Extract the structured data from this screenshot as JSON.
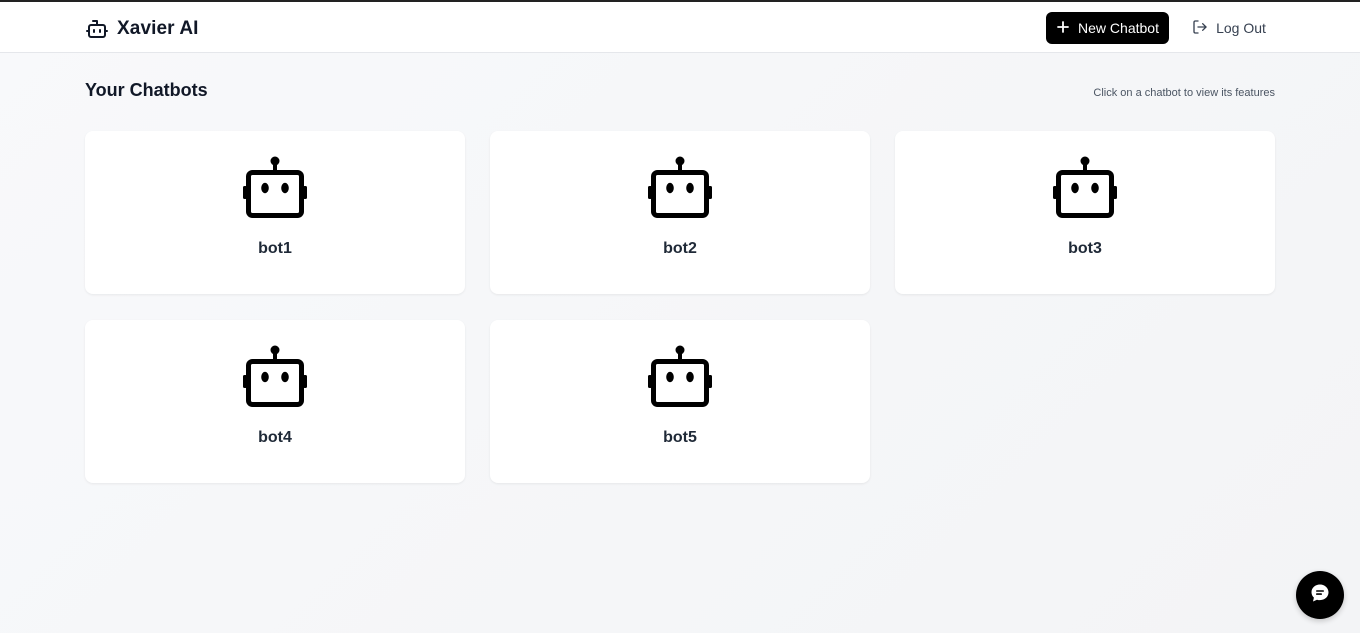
{
  "header": {
    "brand_name": "Xavier AI",
    "brand_icon": "bot-icon",
    "new_chatbot_label": "New Chatbot",
    "logout_label": "Log Out"
  },
  "main": {
    "title": "Your Chatbots",
    "hint": "Click on a chatbot to view its features",
    "chatbots": [
      {
        "name": "bot1",
        "icon": "bot-icon"
      },
      {
        "name": "bot2",
        "icon": "bot-icon"
      },
      {
        "name": "bot3",
        "icon": "bot-icon"
      },
      {
        "name": "bot4",
        "icon": "bot-icon"
      },
      {
        "name": "bot5",
        "icon": "bot-icon"
      }
    ]
  },
  "chat_widget": {
    "icon": "chat-bubble-icon"
  },
  "colors": {
    "primary": "#000000",
    "background": "#f5f6f8",
    "card": "#ffffff",
    "text": "#111827"
  }
}
